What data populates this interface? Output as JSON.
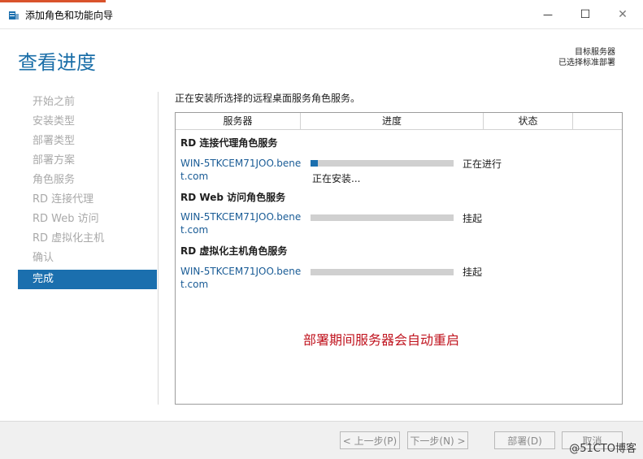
{
  "window": {
    "title": "添加角色和功能向导",
    "controls": {
      "minimize": "—",
      "maximize": "☐",
      "close": "✕"
    },
    "accent_color": "#d9532c"
  },
  "header": {
    "title": "查看进度",
    "target_label": "目标服务器",
    "target_value": "已选择标准部署"
  },
  "steps": [
    {
      "label": "开始之前",
      "active": false
    },
    {
      "label": "安装类型",
      "active": false
    },
    {
      "label": "部署类型",
      "active": false
    },
    {
      "label": "部署方案",
      "active": false
    },
    {
      "label": "角色服务",
      "active": false
    },
    {
      "label": "RD 连接代理",
      "active": false
    },
    {
      "label": "RD Web 访问",
      "active": false
    },
    {
      "label": "RD 虚拟化主机",
      "active": false
    },
    {
      "label": "确认",
      "active": false
    },
    {
      "label": "完成",
      "active": true
    }
  ],
  "main": {
    "intro": "正在安装所选择的远程桌面服务角色服务。",
    "columns": [
      "服务器",
      "进度",
      "状态"
    ],
    "groups": [
      {
        "title": "RD 连接代理角色服务",
        "server": "WIN-5TKCEM71JOO.benet.com",
        "progress": 0.05,
        "status": "正在进行",
        "substatus": "正在安装..."
      },
      {
        "title": "RD Web 访问角色服务",
        "server": "WIN-5TKCEM71JOO.benet.com",
        "progress": 0,
        "status": "挂起",
        "substatus": ""
      },
      {
        "title": "RD 虚拟化主机角色服务",
        "server": "WIN-5TKCEM71JOO.benet.com",
        "progress": 0,
        "status": "挂起",
        "substatus": ""
      }
    ],
    "note": "部署期间服务器会自动重启",
    "note_color": "#c0141f"
  },
  "footer": {
    "prev": "< 上一步(P)",
    "next": "下一步(N) >",
    "deploy": "部署(D)",
    "cancel": "取消"
  },
  "watermark": "@51CTO博客"
}
